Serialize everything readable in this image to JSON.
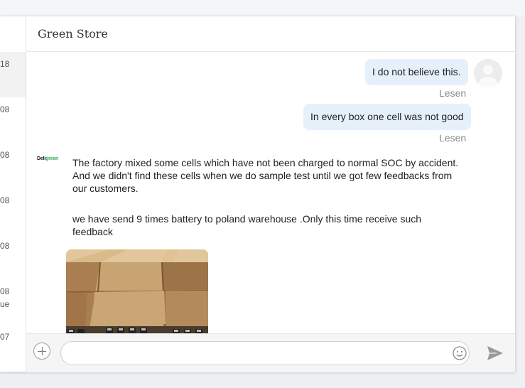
{
  "sidebar": {
    "times": [
      "18",
      "08",
      "08",
      "08",
      "08",
      "08",
      "07"
    ],
    "snippet": "ue"
  },
  "header": {
    "title": "Green Store"
  },
  "messages": {
    "out1": "I do not believe this.",
    "out1_status": "Lesen",
    "out2": "In every box one cell was not good",
    "out2_status": "Lesen",
    "in1": "The factory mixed some cells which have not been charged to normal SOC by accident. And we didn't find these cells when we do sample test until we got few feedbacks from our customers.",
    "in2": "we have send 9 times battery to poland warehouse .Only this time receive such feedback"
  },
  "logo": {
    "text_a": "Deli",
    "text_b": "green"
  },
  "composer": {
    "placeholder": ""
  },
  "icons": {
    "add": "plus-icon",
    "emoji": "smiley-icon",
    "send": "send-icon",
    "avatar": "user-avatar-icon"
  },
  "colors": {
    "outgoing_bubble": "#e6f0fb",
    "read_status": "#8a8a8a",
    "logo_green": "#34a853"
  }
}
